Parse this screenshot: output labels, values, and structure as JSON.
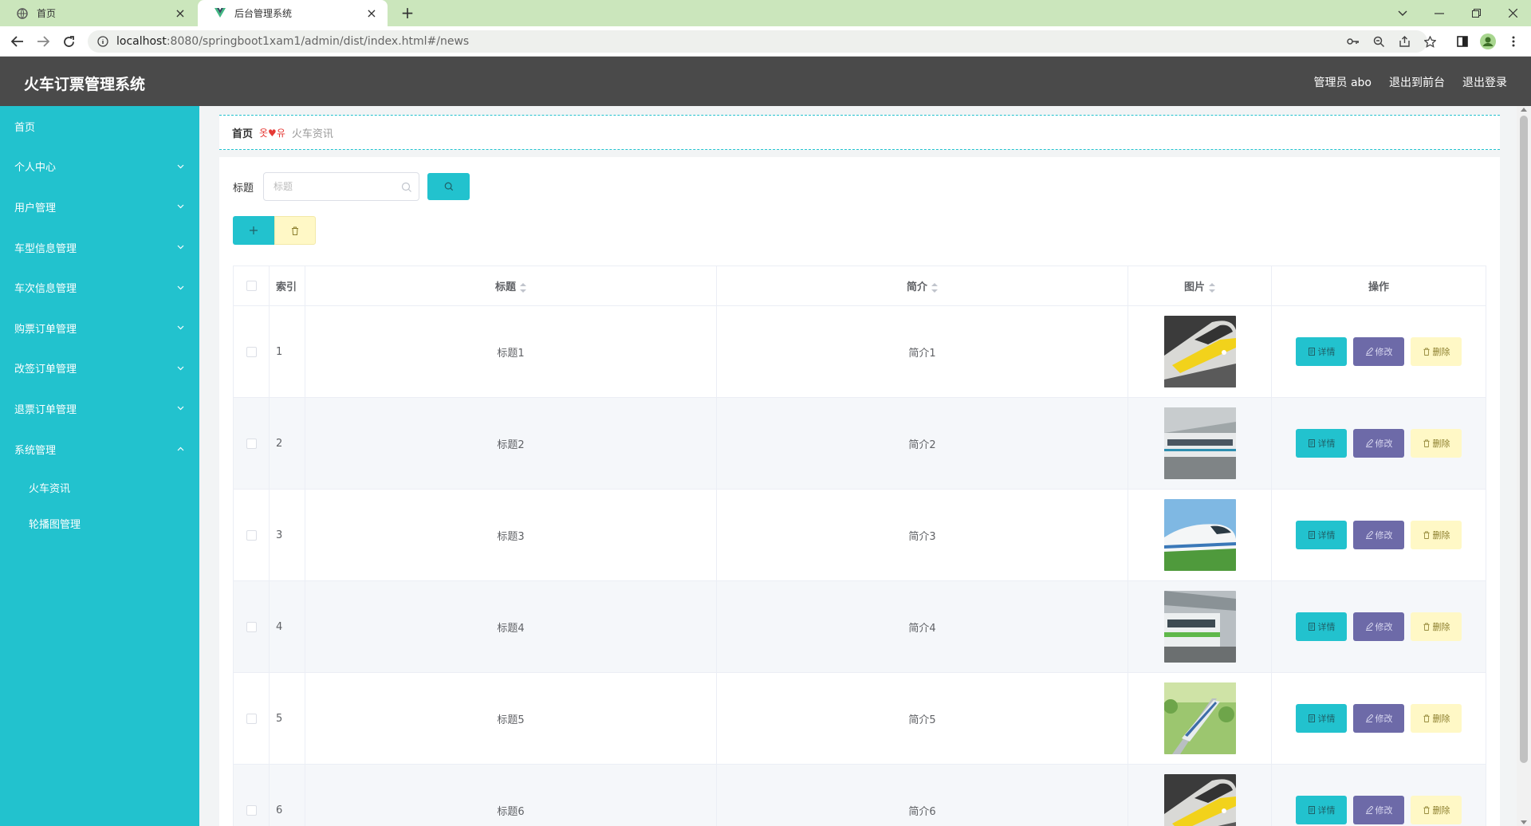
{
  "browser": {
    "tabs": [
      {
        "title": "首页",
        "icon": "globe-icon"
      },
      {
        "title": "后台管理系统",
        "icon": "vue-logo-icon"
      }
    ],
    "url_host": "localhost",
    "url_path": ":8080/springboot1xam1/admin/dist/index.html#/news"
  },
  "app": {
    "brand": "火车订票管理系统",
    "top_links": [
      "管理员 abo",
      "退出到前台",
      "退出登录"
    ]
  },
  "sidebar": {
    "items": [
      {
        "label": "首页",
        "has_children": false
      },
      {
        "label": "个人中心",
        "has_children": true
      },
      {
        "label": "用户管理",
        "has_children": true
      },
      {
        "label": "车型信息管理",
        "has_children": true
      },
      {
        "label": "车次信息管理",
        "has_children": true
      },
      {
        "label": "购票订单管理",
        "has_children": true
      },
      {
        "label": "改签订单管理",
        "has_children": true
      },
      {
        "label": "退票订单管理",
        "has_children": true
      },
      {
        "label": "系统管理",
        "has_children": true,
        "expanded": true
      }
    ],
    "subitems": [
      "火车资讯",
      "轮播图管理"
    ]
  },
  "breadcrumb": {
    "home": "首页",
    "separator": "옷♥유",
    "current": "火车资讯"
  },
  "search": {
    "label": "标题",
    "placeholder": "标题"
  },
  "table": {
    "headers": {
      "index": "索引",
      "title": "标题",
      "brief": "简介",
      "image": "图片",
      "ops": "操作"
    },
    "ops_labels": {
      "detail": "详情",
      "edit": "修改",
      "delete": "删除"
    },
    "rows": [
      {
        "index": "1",
        "title": "标题1",
        "brief": "简介1",
        "image": "train-yellow-front"
      },
      {
        "index": "2",
        "title": "标题2",
        "brief": "简介2",
        "image": "train-station-side"
      },
      {
        "index": "3",
        "title": "标题3",
        "brief": "简介3",
        "image": "train-white-bullet"
      },
      {
        "index": "4",
        "title": "标题4",
        "brief": "简介4",
        "image": "train-platform-green"
      },
      {
        "index": "5",
        "title": "标题5",
        "brief": "简介5",
        "image": "train-countryside"
      },
      {
        "index": "6",
        "title": "标题6",
        "brief": "简介6",
        "image": "train-yellow-front"
      }
    ]
  },
  "colors": {
    "accent": "#22c2ce",
    "header_bg": "#4a4a4a",
    "edit_btn": "#6d6aa8",
    "delete_btn": "#fff8c6"
  }
}
